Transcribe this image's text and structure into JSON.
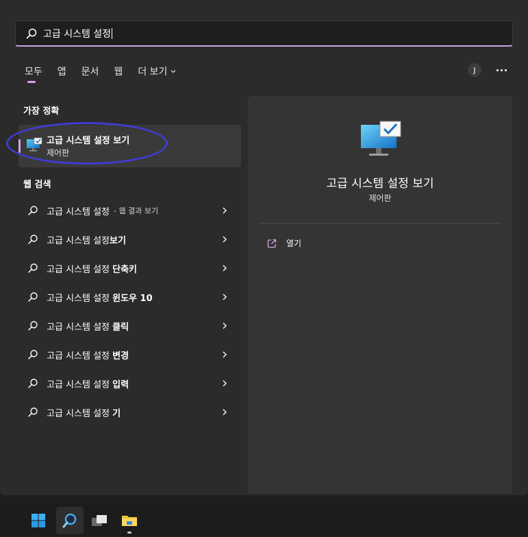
{
  "search": {
    "query": "고급 시스템 설정"
  },
  "tabs": [
    {
      "label": "모두",
      "active": true
    },
    {
      "label": "앱"
    },
    {
      "label": "문서"
    },
    {
      "label": "웹"
    },
    {
      "label": "더 보기"
    }
  ],
  "account": {
    "initial": "J"
  },
  "best_match": {
    "heading": "가장 정확",
    "title": "고급 시스템 설정 보기",
    "subtitle": "제어판"
  },
  "web_search": {
    "heading": "웹 검색",
    "items": [
      {
        "plain": "고급 시스템 설정",
        "bold": "",
        "suffix": "- 웹 결과 보기"
      },
      {
        "plain": "고급 시스템 설정",
        "bold": "보기",
        "suffix": ""
      },
      {
        "plain": "고급 시스템 설정 ",
        "bold": "단축키",
        "suffix": ""
      },
      {
        "plain": "고급 시스템 설정 ",
        "bold": "윈도우 10",
        "suffix": ""
      },
      {
        "plain": "고급 시스템 설정 ",
        "bold": "클릭",
        "suffix": ""
      },
      {
        "plain": "고급 시스템 설정 ",
        "bold": "변경",
        "suffix": ""
      },
      {
        "plain": "고급 시스템 설정 ",
        "bold": "입력",
        "suffix": ""
      },
      {
        "plain": "고급 시스템 설정 ",
        "bold": "기",
        "suffix": ""
      }
    ]
  },
  "preview": {
    "title": "고급 시스템 설정 보기",
    "subtitle": "제어판",
    "actions": [
      {
        "label": "열기"
      }
    ]
  },
  "colors": {
    "accent": "#d6a5e8",
    "annotation_circle": "#3d3dd0",
    "panel": "#2b2b2b"
  }
}
